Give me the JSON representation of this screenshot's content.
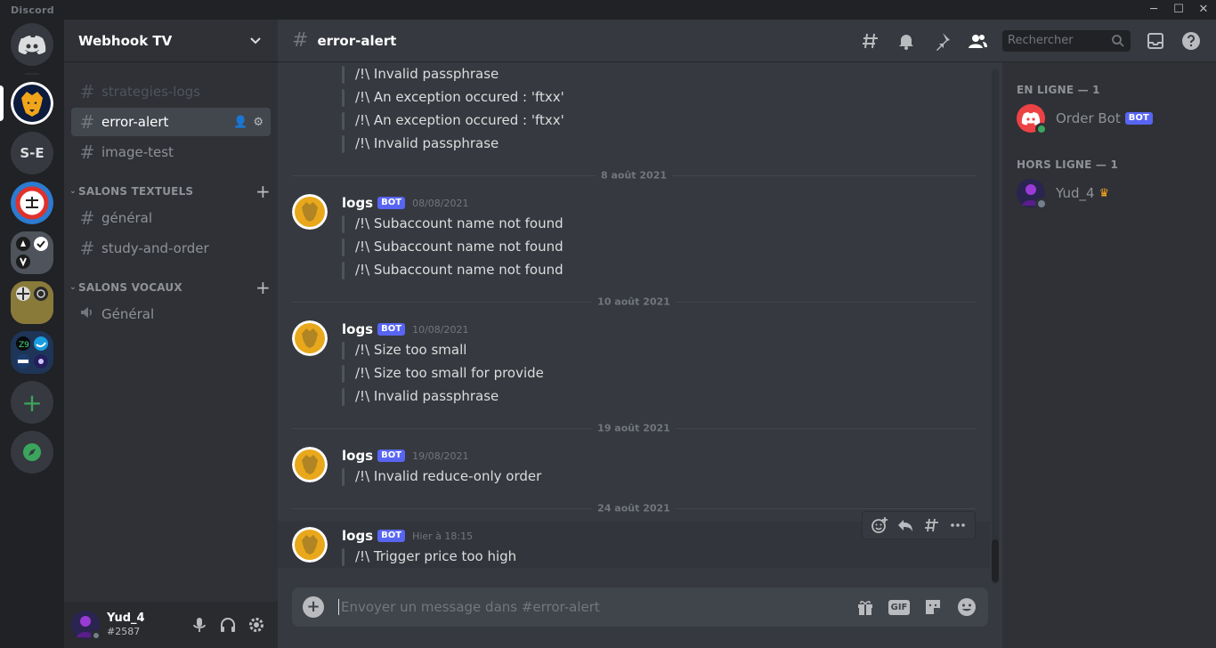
{
  "window": {
    "app_name": "Discord"
  },
  "server": {
    "name": "Webhook TV"
  },
  "rail": {
    "text_server": "S-E"
  },
  "channels": {
    "top": [
      {
        "name": "strategies-logs"
      },
      {
        "name": "error-alert"
      },
      {
        "name": "image-test"
      }
    ],
    "text_category": "SALONS TEXTUELS",
    "text": [
      {
        "name": "général"
      },
      {
        "name": "study-and-order"
      }
    ],
    "voice_category": "SALONS VOCAUX",
    "voice": [
      {
        "name": "Général"
      }
    ]
  },
  "user": {
    "name": "Yud_4",
    "tag": "#2587"
  },
  "header": {
    "channel": "error-alert",
    "search_placeholder": "Rechercher"
  },
  "chat": {
    "orphan_lines": [
      "/!\\ Invalid passphrase",
      "/!\\ An exception occured : 'ftxx'",
      "/!\\ An exception occured : 'ftxx'",
      "/!\\ Invalid passphrase"
    ],
    "groups": [
      {
        "date": "8 août 2021",
        "author": "logs",
        "badge": "BOT",
        "timestamp": "08/08/2021",
        "lines": [
          "/!\\ Subaccount name not found",
          "/!\\ Subaccount name not found",
          "/!\\ Subaccount name not found"
        ]
      },
      {
        "date": "10 août 2021",
        "author": "logs",
        "badge": "BOT",
        "timestamp": "10/08/2021",
        "lines": [
          "/!\\ Size too small",
          "/!\\ Size too small for provide",
          "/!\\ Invalid passphrase"
        ]
      },
      {
        "date": "19 août 2021",
        "author": "logs",
        "badge": "BOT",
        "timestamp": "19/08/2021",
        "lines": [
          "/!\\ Invalid reduce-only order"
        ]
      },
      {
        "date": "24 août 2021",
        "author": "logs",
        "badge": "BOT",
        "timestamp": "Hier à 18:15",
        "lines": [
          "/!\\ Trigger price too high"
        ]
      }
    ]
  },
  "composer": {
    "placeholder": "Envoyer un message dans #error-alert",
    "gif_label": "GIF"
  },
  "members": {
    "online_header": "EN LIGNE — 1",
    "online": [
      {
        "name": "Order Bot",
        "badge": "BOT"
      }
    ],
    "offline_header": "HORS LIGNE — 1",
    "offline": [
      {
        "name": "Yud_4"
      }
    ]
  },
  "colors": {
    "accent": "#5865f2",
    "online": "#3ba55d",
    "offline": "#747f8d",
    "bot_avatar": "#ed4245",
    "logs_avatar_bg": "#e9a81b"
  }
}
